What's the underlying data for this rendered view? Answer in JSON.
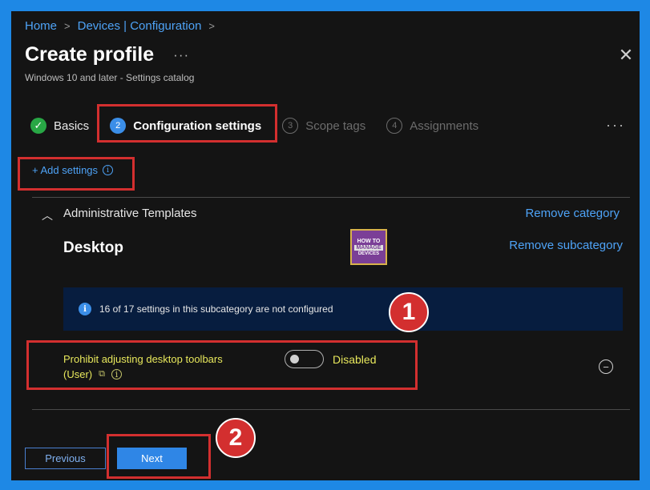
{
  "breadcrumb": {
    "home": "Home",
    "devices": "Devices | Configuration"
  },
  "header": {
    "title": "Create profile",
    "more": "···",
    "subtitle": "Windows 10 and later - Settings catalog",
    "close": "✕"
  },
  "tabs": [
    {
      "num": "✓",
      "label": "Basics",
      "state": "done"
    },
    {
      "num": "2",
      "label": "Configuration settings",
      "state": "active"
    },
    {
      "num": "3",
      "label": "Scope tags",
      "state": "inactive"
    },
    {
      "num": "4",
      "label": "Assignments",
      "state": "inactive"
    }
  ],
  "tabs_more": "···",
  "add_settings": "+ Add settings",
  "category": {
    "toggle": "︿",
    "label": "Administrative Templates",
    "remove": "Remove category"
  },
  "subcategory": {
    "label": "Desktop",
    "remove": "Remove subcategory"
  },
  "logo": {
    "line1": "HOW TO",
    "line2": "MANAGE",
    "line3": "DEVICES"
  },
  "info_bar": {
    "icon": "i",
    "text": "16 of 17 settings in this subcategory are not configured"
  },
  "setting": {
    "name_line1": "Prohibit adjusting desktop toolbars",
    "name_line2": "(User)",
    "state_label": "Disabled",
    "enabled": false
  },
  "footer": {
    "previous": "Previous",
    "next": "Next"
  },
  "annotations": {
    "badge1": "1",
    "badge2": "2"
  },
  "colors": {
    "accent": "#4ea3f7",
    "highlight": "#d32f2f",
    "success": "#28a745",
    "setting_text": "#e8e85c"
  }
}
